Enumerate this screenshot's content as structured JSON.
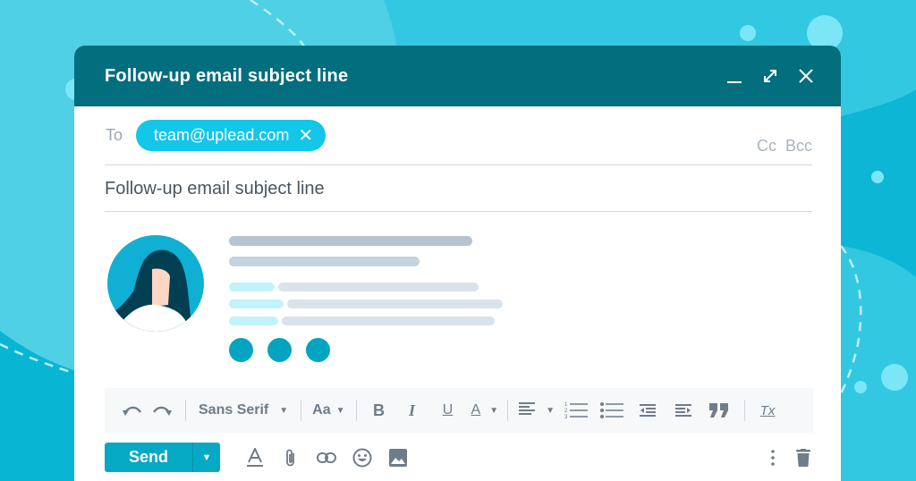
{
  "colors": {
    "background": "#33c8e2",
    "titlebar": "#026e7e",
    "chip": "#14c6e8",
    "send_button": "#06a9c4",
    "accent_dots": "#03a4c0",
    "icon_gray": "#6f7c89"
  },
  "window": {
    "title": "Follow-up email subject line",
    "controls": {
      "minimize_icon": "minimize-icon",
      "expand_icon": "expand-icon",
      "close_icon": "close-icon"
    }
  },
  "recipients": {
    "to_label": "To",
    "chips": [
      {
        "email": "team@uplead.com",
        "remove_glyph": "✕"
      }
    ],
    "cc_label": "Cc",
    "bcc_label": "Bcc"
  },
  "subject": {
    "value": "Follow-up email subject line"
  },
  "body": {
    "avatar_icon": "woman-avatar-icon",
    "placeholder_lines": 5,
    "placeholder_dots": 3
  },
  "toolbar": {
    "undo_icon": "undo-icon",
    "redo_icon": "redo-icon",
    "font_family": "Sans Serif",
    "font_size_label": "Aa",
    "bold_label": "B",
    "italic_label": "I",
    "underline_label": "U",
    "text_color_label": "A",
    "remove_format_label": "Tx",
    "caret": "▼"
  },
  "bottom": {
    "send_label": "Send",
    "send_caret": "▼"
  }
}
